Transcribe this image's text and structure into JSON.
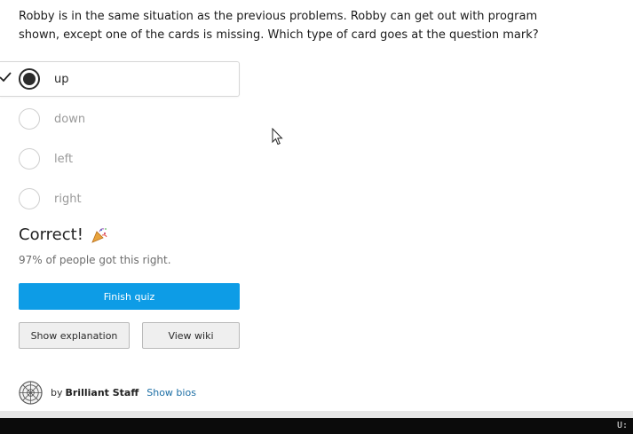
{
  "question": {
    "text": "Robby is in the same situation as the previous problems. Robby can get out with program shown, except one of the cards is missing. Which type of card goes at the question mark?"
  },
  "options": [
    {
      "label": "up",
      "selected": true
    },
    {
      "label": "down",
      "selected": false
    },
    {
      "label": "left",
      "selected": false
    },
    {
      "label": "right",
      "selected": false
    }
  ],
  "result": {
    "title": "Correct!",
    "icon": "party-popper-icon",
    "stat_text": "97% of people got this right."
  },
  "buttons": {
    "finish": "Finish quiz",
    "show_explanation": "Show explanation",
    "view_wiki": "View wiki"
  },
  "author": {
    "by": "by",
    "name": "Brilliant Staff",
    "bios_link": "Show bios"
  },
  "taskbar": {
    "text": "U:"
  },
  "colors": {
    "primary_button": "#0d9ce6",
    "link": "#1d6fa5"
  }
}
